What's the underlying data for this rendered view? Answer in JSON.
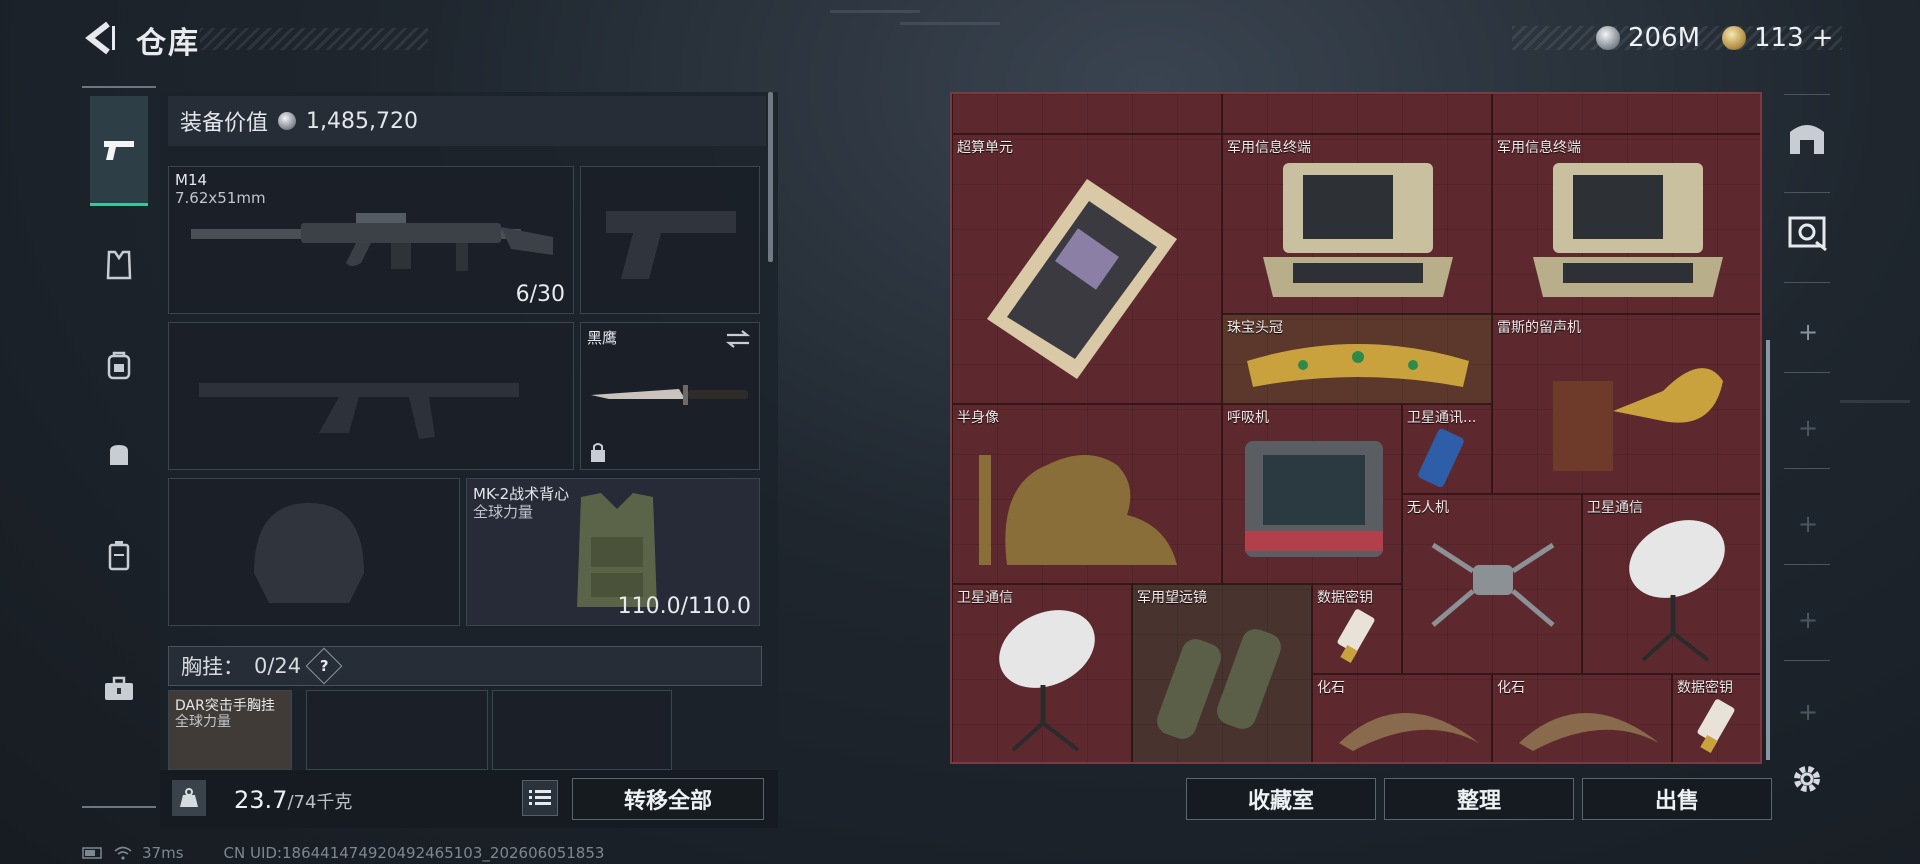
{
  "header": {
    "title": "仓库",
    "silver_amount": "206M",
    "gold_amount": "113",
    "gold_plus": "+"
  },
  "loadout": {
    "value_label": "装备价值",
    "value": "1,485,720",
    "primary_weapon": {
      "name": "M14",
      "caliber": "7.62x51mm",
      "ammo": "6/30"
    },
    "melee": {
      "name": "黑鹰"
    },
    "armor": {
      "name": "MK-2战术背心",
      "quality": "全球力量",
      "durability": "110.0/110.0"
    },
    "chest_rig": {
      "label": "胸挂：",
      "capacity": "0/24",
      "help": "?"
    },
    "chest_item": {
      "name": "DAR突击手胸挂",
      "quality": "全球力量"
    }
  },
  "footer_left": {
    "weight_value": "23.7",
    "weight_max": "/74千克",
    "transfer_all": "转移全部"
  },
  "storage": {
    "items": [
      {
        "id": "supercomputer",
        "name": "超算单元"
      },
      {
        "id": "terminal-1",
        "name": "军用信息终端"
      },
      {
        "id": "terminal-2",
        "name": "军用信息终端"
      },
      {
        "id": "tiara",
        "name": "珠宝头冠"
      },
      {
        "id": "gramophone",
        "name": "雷斯的留声机"
      },
      {
        "id": "bust",
        "name": "半身像"
      },
      {
        "id": "ventilator",
        "name": "呼吸机"
      },
      {
        "id": "sat-phone",
        "name": "卫星通讯..."
      },
      {
        "id": "drone",
        "name": "无人机"
      },
      {
        "id": "sat-dish-1",
        "name": "卫星通信"
      },
      {
        "id": "sat-dish-2",
        "name": "卫星通信"
      },
      {
        "id": "binoculars",
        "name": "军用望远镜"
      },
      {
        "id": "key-1",
        "name": "数据密钥"
      },
      {
        "id": "fossil-1",
        "name": "化石"
      },
      {
        "id": "fossil-2",
        "name": "化石"
      },
      {
        "id": "key-2",
        "name": "数据密钥"
      }
    ]
  },
  "footer_right": {
    "collection": "收藏室",
    "sort": "整理",
    "sell": "出售"
  },
  "status": {
    "ping": "37ms",
    "uid": "CN UID:186441474920492465103_202606051853"
  },
  "colors": {
    "accent": "#39c79a",
    "storage_bg": "#5c2a30"
  }
}
